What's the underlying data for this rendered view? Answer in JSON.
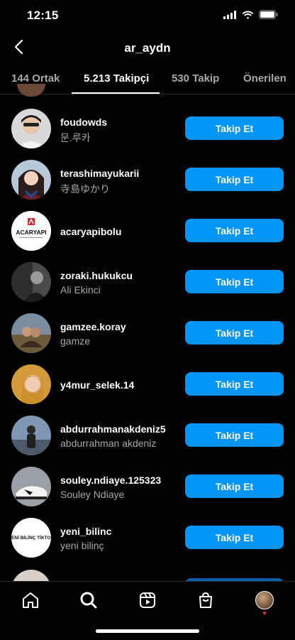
{
  "status": {
    "time": "12:15"
  },
  "header": {
    "title": "ar_aydn"
  },
  "tabs": [
    {
      "label": "144 Ortak",
      "active": false
    },
    {
      "label": "5.213 Takipçi",
      "active": true
    },
    {
      "label": "530 Takip",
      "active": false
    },
    {
      "label": "Önerilen",
      "active": false
    }
  ],
  "colors": {
    "accent": "#0095f6",
    "background": "#000000",
    "secondary_text": "#a8a8a8"
  },
  "follow_label": "Takip Et",
  "followers": [
    {
      "username": "foudowds",
      "fullname": "문.루카"
    },
    {
      "username": "terashimayukarii",
      "fullname": "寺島ゆかり"
    },
    {
      "username": "acaryapibolu",
      "fullname": "",
      "logo_text": "ACARYAPI"
    },
    {
      "username": "zoraki.hukukcu",
      "fullname": "Ali Ekinci"
    },
    {
      "username": "gamzee.koray",
      "fullname": "gamze"
    },
    {
      "username": "y4mur_selek.14",
      "fullname": ""
    },
    {
      "username": "abdurrahmanakdeniz5",
      "fullname": "abdurrahman akdeniz"
    },
    {
      "username": "souley.ndiaye.125323",
      "fullname": "Souley Ndiaye"
    },
    {
      "username": "yeni_bilinc",
      "fullname": "yeni bilinç",
      "logo_text": "YENİ BİLİNÇ TİKTOK"
    }
  ],
  "nav": [
    "home-icon",
    "search-icon",
    "reels-icon",
    "shop-icon",
    "profile-avatar"
  ]
}
